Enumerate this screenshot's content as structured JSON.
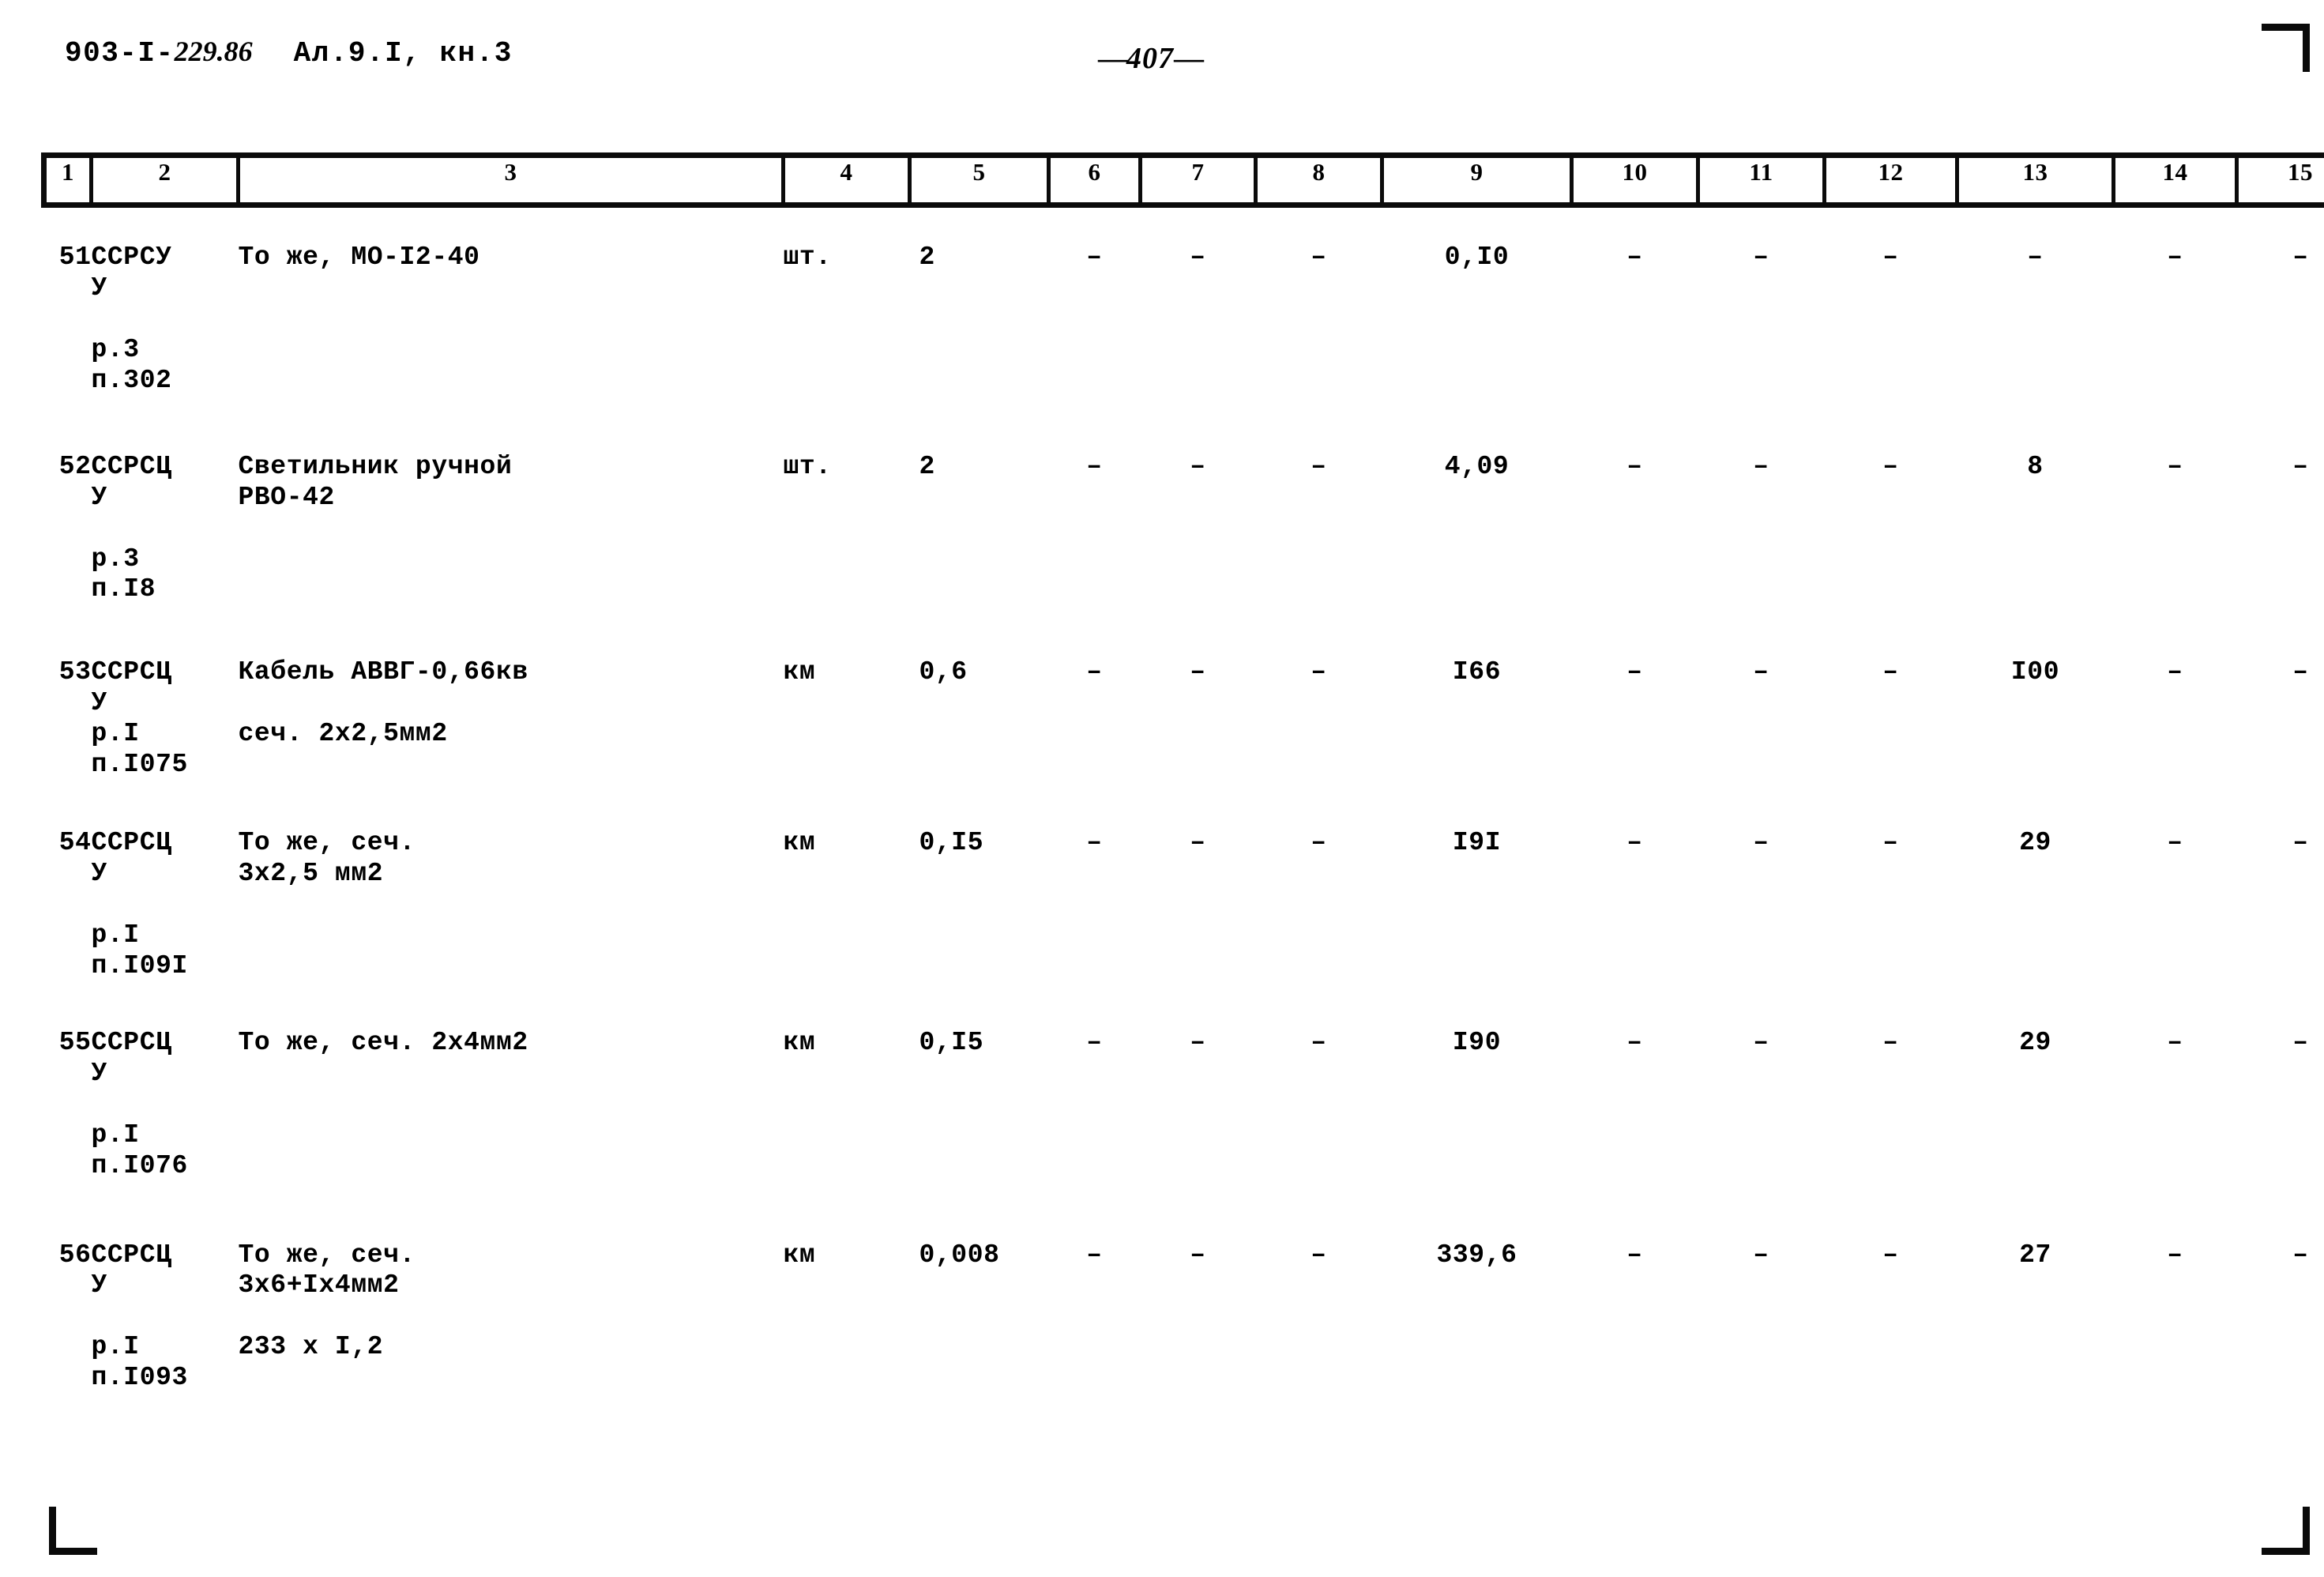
{
  "document": {
    "code_prefix": "903-I-",
    "code_suffix": "229.86",
    "album": "Ал.9.I, кн.3",
    "page_number": "407",
    "page_dash_left": "—",
    "page_dash_right": "—"
  },
  "table": {
    "column_headers": [
      "1",
      "2",
      "3",
      "4",
      "5",
      "6",
      "7",
      "8",
      "9",
      "10",
      "11",
      "12",
      "13",
      "14",
      "15"
    ],
    "rows": [
      {
        "num": "51",
        "code": "ССРСУ\nУ\n\nр.3\nп.302",
        "description": "То же, МО-I2-40",
        "unit": "шт.",
        "c5": "2",
        "c6": "–",
        "c7": "–",
        "c8": "–",
        "c9": "0,I0",
        "c10": "–",
        "c11": "–",
        "c12": "–",
        "c13": "–",
        "c14": "–",
        "c15": "–"
      },
      {
        "num": "52",
        "code": "ССРСЦ\nУ\n\nр.3\nп.I8",
        "description": "Светильник ручной\nРВО-42",
        "unit": "шт.",
        "c5": "2",
        "c6": "–",
        "c7": "–",
        "c8": "–",
        "c9": "4,09",
        "c10": "–",
        "c11": "–",
        "c12": "–",
        "c13": "8",
        "c14": "–",
        "c15": "–"
      },
      {
        "num": "53",
        "code": "ССРСЦ\nУ\nр.I\nп.I075",
        "description": "Кабель АВВГ-0,66кв\n\nсеч. 2х2,5мм2",
        "unit": "км",
        "c5": "0,6",
        "c6": "–",
        "c7": "–",
        "c8": "–",
        "c9": "I66",
        "c10": "–",
        "c11": "–",
        "c12": "–",
        "c13": "I00",
        "c14": "–",
        "c15": "–"
      },
      {
        "num": "54",
        "code": "ССРСЦ\nУ\n\nр.I\nп.I09I",
        "description": "То же, сеч.\n      3х2,5 мм2",
        "unit": "км",
        "c5": "0,I5",
        "c6": "–",
        "c7": "–",
        "c8": "–",
        "c9": "I9I",
        "c10": "–",
        "c11": "–",
        "c12": "–",
        "c13": "29",
        "c14": "–",
        "c15": "–"
      },
      {
        "num": "55",
        "code": "ССРСЦ\nУ\n\nр.I\nп.I076",
        "description": "То же, сеч. 2х4мм2",
        "unit": "км",
        "c5": "0,I5",
        "c6": "–",
        "c7": "–",
        "c8": "–",
        "c9": "I90",
        "c10": "–",
        "c11": "–",
        "c12": "–",
        "c13": "29",
        "c14": "–",
        "c15": "–"
      },
      {
        "num": "56",
        "code": "ССРСЦ\nУ\n\nр.I\nп.I093",
        "description": "То же, сеч.\n   3х6+Iх4мм2\n\n  233 х I,2",
        "unit": "км",
        "c5": "0,008",
        "c6": "–",
        "c7": "–",
        "c8": "–",
        "c9": "339,6",
        "c10": "–",
        "c11": "–",
        "c12": "–",
        "c13": "27",
        "c14": "–",
        "c15": "–"
      }
    ]
  }
}
